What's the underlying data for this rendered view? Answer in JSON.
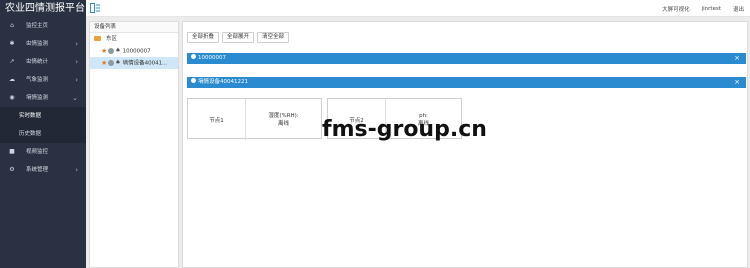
{
  "app": {
    "title": "农业四情测报平台"
  },
  "sidebar": {
    "items": [
      {
        "label": "监控主页",
        "icon": "home-icon",
        "has_arrow": false
      },
      {
        "label": "虫情监测",
        "icon": "bug-icon",
        "has_arrow": true
      },
      {
        "label": "虫情统计",
        "icon": "chart-line-icon",
        "has_arrow": true
      },
      {
        "label": "气象监测",
        "icon": "cloud-icon",
        "has_arrow": true
      },
      {
        "label": "墒情监测",
        "icon": "globe-icon",
        "has_arrow": true
      }
    ],
    "submenu": [
      {
        "label": "实时数据",
        "active": true
      },
      {
        "label": "历史数据",
        "active": false
      }
    ],
    "items_after": [
      {
        "label": "视频监控",
        "icon": "video-icon",
        "has_arrow": false
      },
      {
        "label": "系统管理",
        "icon": "gear-icon",
        "has_arrow": true
      }
    ]
  },
  "topbar": {
    "links": [
      "大屏可视化",
      "jinrtest",
      "退出"
    ]
  },
  "tree": {
    "title": "设备列表",
    "root": "东区",
    "children": [
      {
        "label": "10000007",
        "selected": false
      },
      {
        "label": "墒情设备40041...",
        "selected": true
      }
    ]
  },
  "toolbar": {
    "buttons": [
      "全部折叠",
      "全部展开",
      "清空全部"
    ]
  },
  "devices": [
    {
      "title": "10000007"
    },
    {
      "title": "墒情设备40041221"
    }
  ],
  "nodes": [
    {
      "name": "节点1",
      "reading_label": "湿度(%RH):",
      "reading_value": "离线"
    },
    {
      "name": "节点2",
      "reading_label": "ph:",
      "reading_value": "离线"
    }
  ],
  "watermark": "fms-group.cn",
  "colors": {
    "sidebar_bg": "#2a3142",
    "accent_blue": "#2b8bd0",
    "selected_row": "#cfe7f7"
  }
}
